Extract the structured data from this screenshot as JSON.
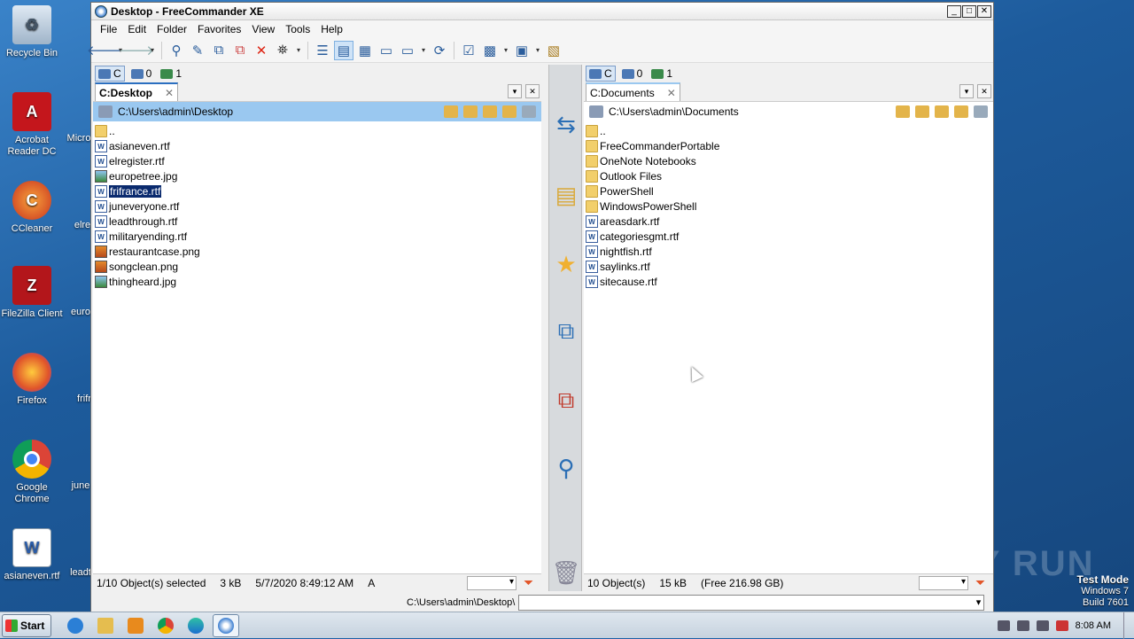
{
  "desktop": {
    "icons": [
      {
        "label": "Recycle Bin",
        "icon": "recycle-bin-icon"
      },
      {
        "label": "Acrobat Reader DC",
        "icon": "acrobat-icon"
      },
      {
        "label": "CCleaner",
        "icon": "ccleaner-icon"
      },
      {
        "label": "FileZilla Client",
        "icon": "filezilla-icon"
      },
      {
        "label": "Firefox",
        "icon": "firefox-icon"
      },
      {
        "label": "Google Chrome",
        "icon": "chrome-icon"
      },
      {
        "label": "asianeven.rtf",
        "icon": "word-doc-icon"
      }
    ],
    "partial_icons": [
      "Micro",
      "elre",
      "euro",
      "frifr",
      "june",
      "leadt"
    ]
  },
  "window": {
    "title": "Desktop - FreeCommander XE",
    "menu": [
      "File",
      "Edit",
      "Folder",
      "Favorites",
      "View",
      "Tools",
      "Help"
    ]
  },
  "left": {
    "drives": {
      "c": "C",
      "net": "0",
      "remote": "1"
    },
    "tab": "C:Desktop",
    "path": "C:\\Users\\admin\\Desktop",
    "files": [
      {
        "name": "..",
        "type": "folder"
      },
      {
        "name": "asianeven.rtf",
        "type": "rtf"
      },
      {
        "name": "elregister.rtf",
        "type": "rtf"
      },
      {
        "name": "europetree.jpg",
        "type": "img"
      },
      {
        "name": "frifrance.rtf",
        "type": "rtf",
        "selected": true
      },
      {
        "name": "juneveryone.rtf",
        "type": "rtf"
      },
      {
        "name": "leadthrough.rtf",
        "type": "rtf"
      },
      {
        "name": "militaryending.rtf",
        "type": "rtf"
      },
      {
        "name": "restaurantcase.png",
        "type": "png"
      },
      {
        "name": "songclean.png",
        "type": "png"
      },
      {
        "name": "thingheard.jpg",
        "type": "img"
      }
    ],
    "status": {
      "selection": "1/10 Object(s) selected",
      "size": "3 kB",
      "date": "5/7/2020 8:49:12 AM",
      "attr": "A"
    }
  },
  "right": {
    "drives": {
      "c": "C",
      "net": "0",
      "remote": "1"
    },
    "tab": "C:Documents",
    "path": "C:\\Users\\admin\\Documents",
    "files": [
      {
        "name": "..",
        "type": "folder"
      },
      {
        "name": "FreeCommanderPortable",
        "type": "folder"
      },
      {
        "name": "OneNote Notebooks",
        "type": "folder"
      },
      {
        "name": "Outlook Files",
        "type": "folder"
      },
      {
        "name": "PowerShell",
        "type": "folder"
      },
      {
        "name": "WindowsPowerShell",
        "type": "folder"
      },
      {
        "name": "areasdark.rtf",
        "type": "rtf"
      },
      {
        "name": "categoriesgmt.rtf",
        "type": "rtf"
      },
      {
        "name": "nightfish.rtf",
        "type": "rtf"
      },
      {
        "name": "saylinks.rtf",
        "type": "rtf"
      },
      {
        "name": "sitecause.rtf",
        "type": "rtf"
      }
    ],
    "status": {
      "selection": "10 Object(s)",
      "size": "15 kB",
      "free": "(Free 216.98 GB)"
    }
  },
  "cmdline": {
    "label": "C:\\Users\\admin\\Desktop\\"
  },
  "taskbar": {
    "start": "Start",
    "time": "8:08 AM"
  },
  "watermark": "ANY RUN",
  "testmode": {
    "line1": "Test Mode",
    "line2": "Windows 7",
    "line3": "Build 7601"
  }
}
